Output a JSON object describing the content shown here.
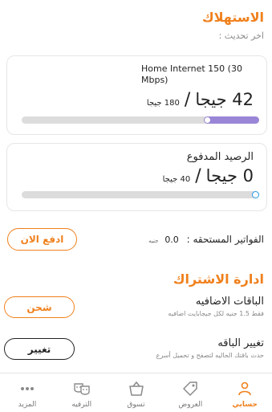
{
  "consumption": {
    "title": "الاستهلاك",
    "last_update": "اخر تحديث :"
  },
  "internet_card": {
    "plan_name": "Home Internet 150 (30 Mbps)",
    "remaining": "42 جيجا",
    "separator": "/",
    "total": "180 جيجا",
    "progress_fraction": 0.233
  },
  "balance_card": {
    "title": "الرصيد المدفوع",
    "remaining": "0 جيجا",
    "separator": "/",
    "total": "40 جيجا",
    "progress_fraction": 0.0
  },
  "bills": {
    "label": "الفواتير المستحقه :",
    "value": "0.0",
    "currency": "جنيه",
    "pay_button": "ادفع الان"
  },
  "subscription": {
    "title": "ادارة الاشتراك",
    "addons_title": "الباقات الاضافيه",
    "addons_desc": "فقط 1.5 جنيه لكل جيجابايت اضافيه",
    "charge_button": "شحن",
    "change_title": "تغيير الباقه",
    "change_desc": "حدث باقتك الحاليه لتصفح و تحميل أسرع",
    "change_button": "تغيير"
  },
  "nav": {
    "account": "حسابي",
    "offers": "العروض",
    "shop": "تسوق",
    "entertainment": "الترفيه",
    "more": "المزيد"
  },
  "colors": {
    "accent": "#f0801c",
    "progress_purple": "#9a86d6",
    "progress_blue": "#2a9be6"
  }
}
